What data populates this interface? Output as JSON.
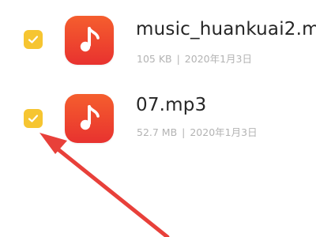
{
  "accent_color": "#F6C531",
  "icon_gradient_top": "#F55E2E",
  "icon_gradient_bottom": "#E8322F",
  "annotation_color": "#E8403A",
  "files": [
    {
      "name": "music_huankuai2.m",
      "size": "105 KB",
      "separator": "|",
      "date": "2020年1月3日",
      "selected": true,
      "icon": "music-note-icon"
    },
    {
      "name": "07.mp3",
      "size": "52.7 MB",
      "separator": "|",
      "date": "2020年1月3日",
      "selected": true,
      "icon": "music-note-icon"
    }
  ],
  "annotation": {
    "icon": "red-pointer-arrow"
  }
}
